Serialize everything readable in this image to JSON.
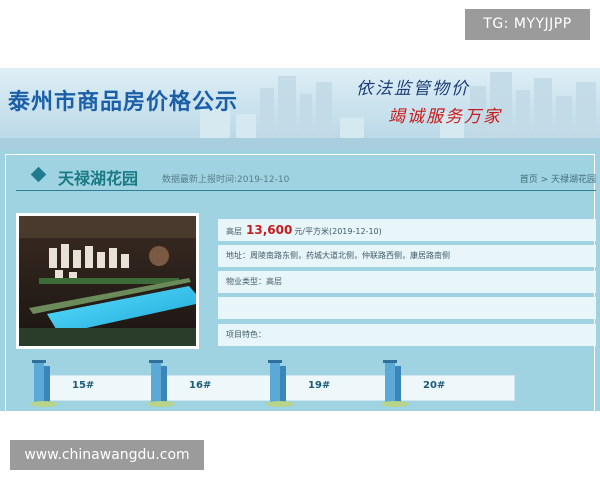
{
  "watermark_tg": "TG: MYYJJPP",
  "watermark_url": "www.chinawangdu.com",
  "banner": {
    "title": "泰州市商品房价格公示",
    "slogan_line1": "依法监管物价",
    "slogan_line2": "竭诚服务万家"
  },
  "project": {
    "name": "天禄湖花园",
    "update_label": "数据最新上报时间:2019-12-10",
    "breadcrumb": "首页 > 天禄湖花园"
  },
  "info": {
    "price_prefix": "高层",
    "price_value": "13,600",
    "price_unit": "元/平方米(2019-12-10)",
    "address": "地址：周陵南路东侧，药城大道北侧，仲联路西侧，康居路南侧",
    "property_type": "物业类型：高层",
    "empty_row": "",
    "features": "项目特色："
  },
  "buildings": [
    {
      "label": "15#"
    },
    {
      "label": "16#"
    },
    {
      "label": "19#"
    },
    {
      "label": "20#"
    }
  ],
  "colors": {
    "accent": "#1a7a84",
    "price": "#c81b1b",
    "panel": "#9fd3e2"
  }
}
